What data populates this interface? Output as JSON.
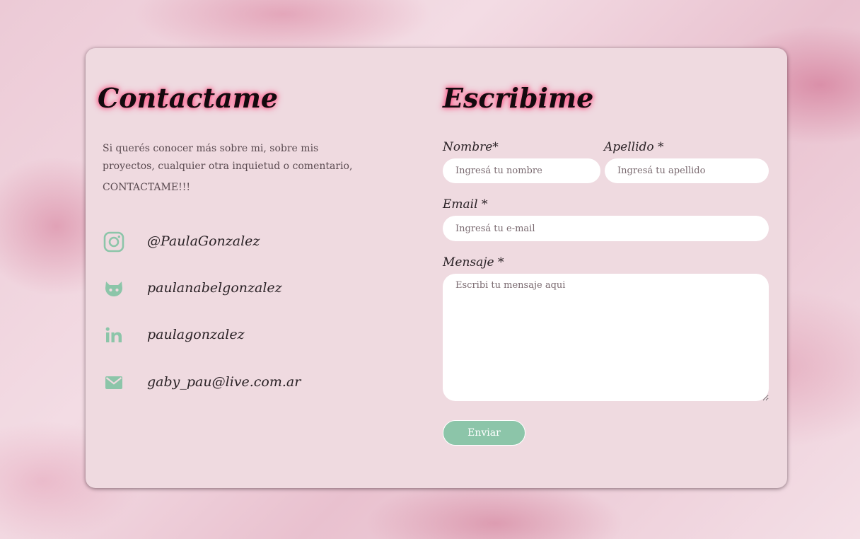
{
  "contact": {
    "title": "Contactame",
    "intro": "Si querés conocer más sobre mi, sobre mis proyectos, cualquier otra inquietud o comentario,",
    "shout": "CONTACTAME!!!",
    "links": [
      {
        "icon": "instagram-icon",
        "text": "@PaulaGonzalez"
      },
      {
        "icon": "github-icon",
        "text": "paulanabelgonzalez"
      },
      {
        "icon": "linkedin-icon",
        "text": "paulagonzalez"
      },
      {
        "icon": "mail-icon",
        "text": "gaby_pau@live.com.ar"
      }
    ]
  },
  "form": {
    "title": "Escribime",
    "nombre_label": "Nombre*",
    "nombre_placeholder": "Ingresá tu nombre",
    "apellido_label": "Apellido *",
    "apellido_placeholder": "Ingresá tu apellido",
    "email_label": "Email *",
    "email_placeholder": "Ingresá tu e-mail",
    "mensaje_label": "Mensaje *",
    "mensaje_placeholder": "Escribi tu mensaje aqui",
    "send_label": "Enviar"
  },
  "colors": {
    "card": "#efdae0",
    "icon": "#8cc5a9",
    "button": "#8cc5a9",
    "heading_glow": "#ff5c8d"
  }
}
